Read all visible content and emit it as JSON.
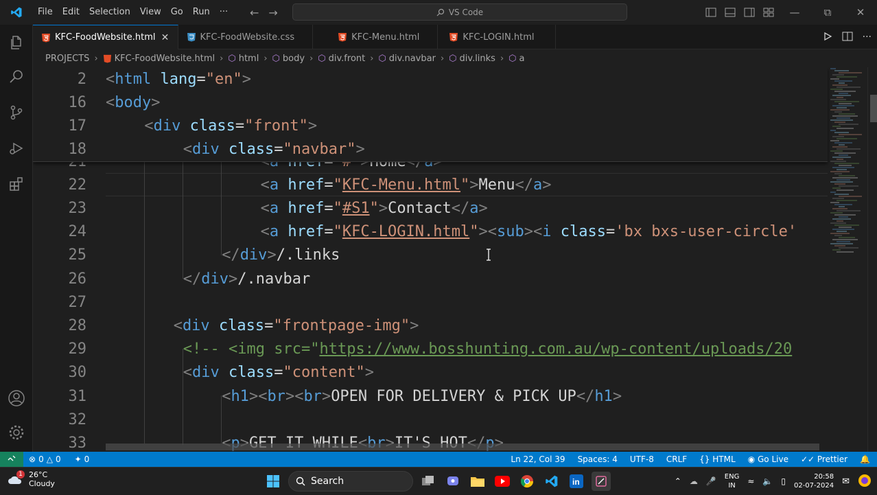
{
  "titlebar": {
    "menu": [
      "File",
      "Edit",
      "Selection",
      "View",
      "Go",
      "Run",
      "···"
    ],
    "search_placeholder": "VS Code"
  },
  "tabs": [
    {
      "label": "KFC-FoodWebsite.html",
      "icon": "html5-icon",
      "active": true
    },
    {
      "label": "KFC-FoodWebsite.css",
      "icon": "css3-icon",
      "active": false
    },
    {
      "label": "KFC-Menu.html",
      "icon": "html5-icon",
      "active": false
    },
    {
      "label": "KFC-LOGIN.html",
      "icon": "html5-icon",
      "active": false
    }
  ],
  "breadcrumb": [
    "PROJECTS",
    "KFC-FoodWebsite.html",
    "html",
    "body",
    "div.front",
    "div.navbar",
    "div.links",
    "a"
  ],
  "sticky_lines": [
    {
      "n": "2",
      "text": "<html lang=\"en\">"
    },
    {
      "n": "16",
      "text": "<body>"
    },
    {
      "n": "17",
      "text": "<div class=\"front\">"
    },
    {
      "n": "18",
      "text": "<div class=\"navbar\">"
    }
  ],
  "code_lines": [
    {
      "n": "21",
      "text": "<a href=\"#\">Home</a>"
    },
    {
      "n": "22",
      "text": "<a href=\"KFC-Menu.html\">Menu</a>"
    },
    {
      "n": "23",
      "text": "<a href=\"#S1\">Contact</a>"
    },
    {
      "n": "24",
      "text": "<a href=\"KFC-LOGIN.html\"><sub><i class='bx bxs-user-circle'"
    },
    {
      "n": "25",
      "text": "</div>/.links"
    },
    {
      "n": "26",
      "text": "</div>/.navbar"
    },
    {
      "n": "27",
      "text": ""
    },
    {
      "n": "28",
      "text": "<div class=\"frontpage-img\">"
    },
    {
      "n": "29",
      "text": "<!-- <img src=\"https://www.bosshunting.com.au/wp-content/uploads/20"
    },
    {
      "n": "30",
      "text": "<div class=\"content\">"
    },
    {
      "n": "31",
      "text": "<h1><br><br>OPEN FOR DELIVERY & PICK UP</h1>"
    },
    {
      "n": "32",
      "text": ""
    },
    {
      "n": "33",
      "text": "<p>GET IT WHILE<br>IT'S HOT</p>"
    }
  ],
  "statusbar": {
    "errors": "0",
    "warnings": "0",
    "ports": "0",
    "position": "Ln 22, Col 39",
    "spaces": "Spaces: 4",
    "encoding": "UTF-8",
    "eol": "CRLF",
    "language": "HTML",
    "golive": "Go Live",
    "prettier": "Prettier"
  },
  "taskbar": {
    "weather_temp": "26°C",
    "weather_desc": "Cloudy",
    "weather_badge": "1",
    "search": "Search",
    "lang1": "ENG",
    "lang2": "IN",
    "time": "20:58",
    "date": "02-07-2024"
  },
  "colors": {
    "tag": "#569cd6",
    "attr": "#9cdcfe",
    "value": "#ce9178",
    "bracket": "#808080",
    "comment": "#6a9955",
    "accent": "#007acc"
  }
}
